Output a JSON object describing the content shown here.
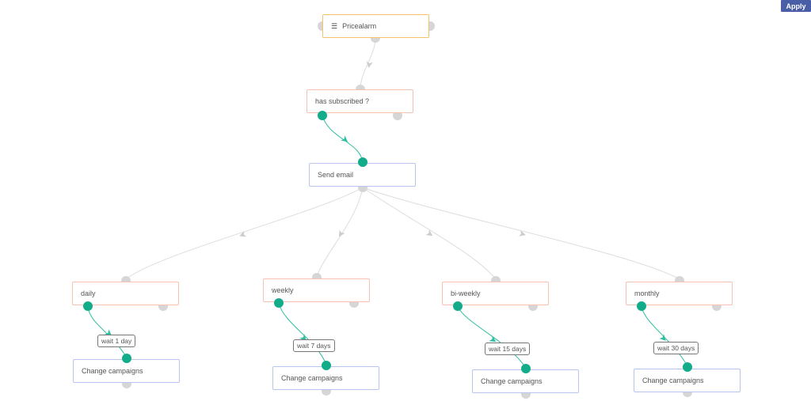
{
  "toolbar": {
    "apply_label": "Apply"
  },
  "icons": {
    "trigger": "list-icon"
  },
  "colors": {
    "trigger_border": "#f5c26b",
    "condition_border": "#f8c1b0",
    "action_border": "#b8c4ee",
    "active_port": "#13ac8b",
    "inactive_port": "#d6d6d6",
    "active_edge": "#2fbf9f",
    "inactive_edge": "#dddddd",
    "apply_bg": "#4a5ea8"
  },
  "nodes": {
    "trigger": {
      "label": "Pricealarm",
      "type": "trigger"
    },
    "subscribed": {
      "label": "has subscribed ?",
      "type": "condition"
    },
    "send_email": {
      "label": "Send email",
      "type": "action"
    },
    "branches": [
      {
        "condition": "daily",
        "wait": "wait 1 day",
        "action": "Change campaigns"
      },
      {
        "condition": "weekly",
        "wait": "wait 7 days",
        "action": "Change campaigns"
      },
      {
        "condition": "bi-weekly",
        "wait": "wait 15 days",
        "action": "Change campaigns"
      },
      {
        "condition": "monthly",
        "wait": "wait 30 days",
        "action": "Change campaigns"
      }
    ]
  }
}
